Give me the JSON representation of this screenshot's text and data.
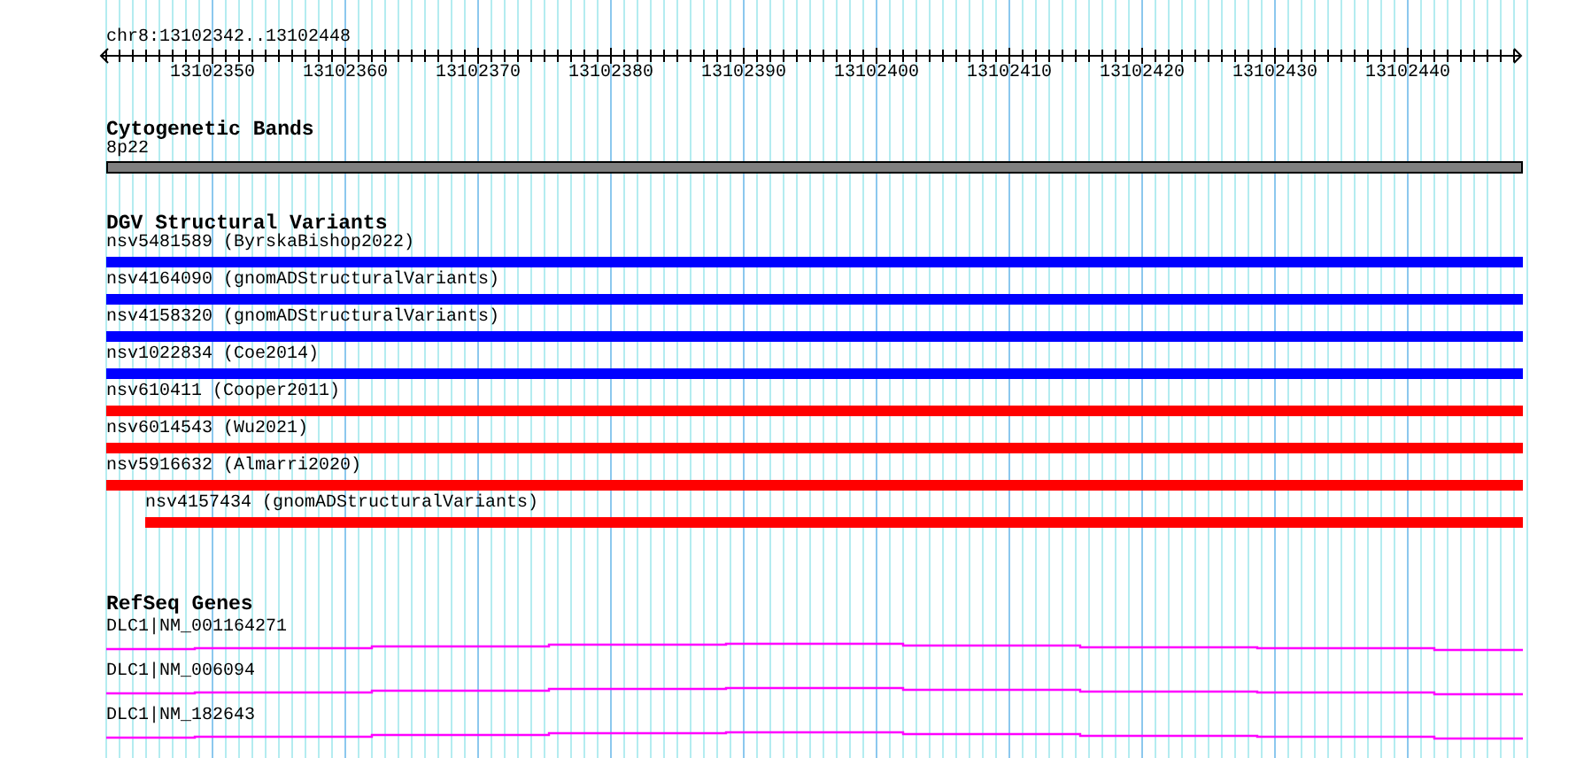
{
  "location": "chr8:13102342..13102448",
  "ruler": {
    "ticks": [
      "13102350",
      "13102360",
      "13102370",
      "13102380",
      "13102390",
      "13102400",
      "13102410",
      "13102420",
      "13102430",
      "13102440"
    ]
  },
  "cytobands": {
    "title": "Cytogenetic Bands",
    "features": [
      {
        "label": "8p22"
      }
    ]
  },
  "variants": {
    "title": "DGV Structural Variants",
    "features": [
      {
        "label": "nsv5481589 (ByrskaBishop2022)",
        "color": "#0000ff",
        "clipped_left": true
      },
      {
        "label": "nsv4164090 (gnomADStructuralVariants)",
        "color": "#0000ff",
        "clipped_left": true
      },
      {
        "label": "nsv4158320 (gnomADStructuralVariants)",
        "color": "#0000ff",
        "clipped_left": true
      },
      {
        "label": "nsv1022834 (Coe2014)",
        "color": "#0000ff",
        "clipped_left": true
      },
      {
        "label": "nsv610411 (Cooper2011)",
        "color": "#ff0000",
        "clipped_left": true
      },
      {
        "label": "nsv6014543 (Wu2021)",
        "color": "#ff0000",
        "clipped_left": true
      },
      {
        "label": "nsv5916632 (Almarri2020)",
        "color": "#ff0000",
        "clipped_left": true
      },
      {
        "label": "nsv4157434 (gnomADStructuralVariants)",
        "color": "#ff0000",
        "clipped_left": false
      }
    ]
  },
  "genes": {
    "title": "RefSeq Genes",
    "features": [
      {
        "label": "DLC1|NM_001164271"
      },
      {
        "label": "DLC1|NM_006094"
      },
      {
        "label": "DLC1|NM_182643"
      }
    ]
  }
}
